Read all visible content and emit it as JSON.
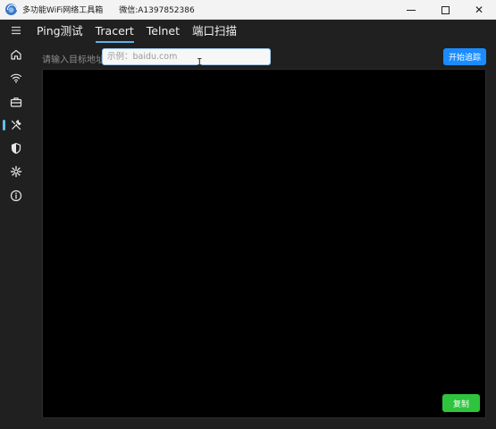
{
  "window": {
    "title": "多功能WiFi网络工具箱",
    "wechat": "微信:A1397852386"
  },
  "sidebar": {
    "items": [
      {
        "icon": "menu-icon"
      },
      {
        "icon": "home-icon"
      },
      {
        "icon": "wifi-icon"
      },
      {
        "icon": "toolbox-icon"
      },
      {
        "icon": "tools-icon",
        "active": true
      },
      {
        "icon": "shield-icon"
      },
      {
        "icon": "gear-icon"
      },
      {
        "icon": "info-icon"
      }
    ]
  },
  "tabs": [
    {
      "label": "Ping测试"
    },
    {
      "label": "Tracert",
      "active": true
    },
    {
      "label": "Telnet"
    },
    {
      "label": "端口扫描"
    }
  ],
  "form": {
    "target_label": "请输入目标地址",
    "target_value": "",
    "target_placeholder": "示例：baidu.com",
    "start_label": "开始追踪"
  },
  "output": {
    "text": "",
    "copy_label": "复制"
  },
  "colors": {
    "accent": "#1a8cff",
    "tab_underline": "#5ab4e5",
    "copy_button": "#2ec43e",
    "background": "#202020",
    "output_bg": "#000000"
  }
}
